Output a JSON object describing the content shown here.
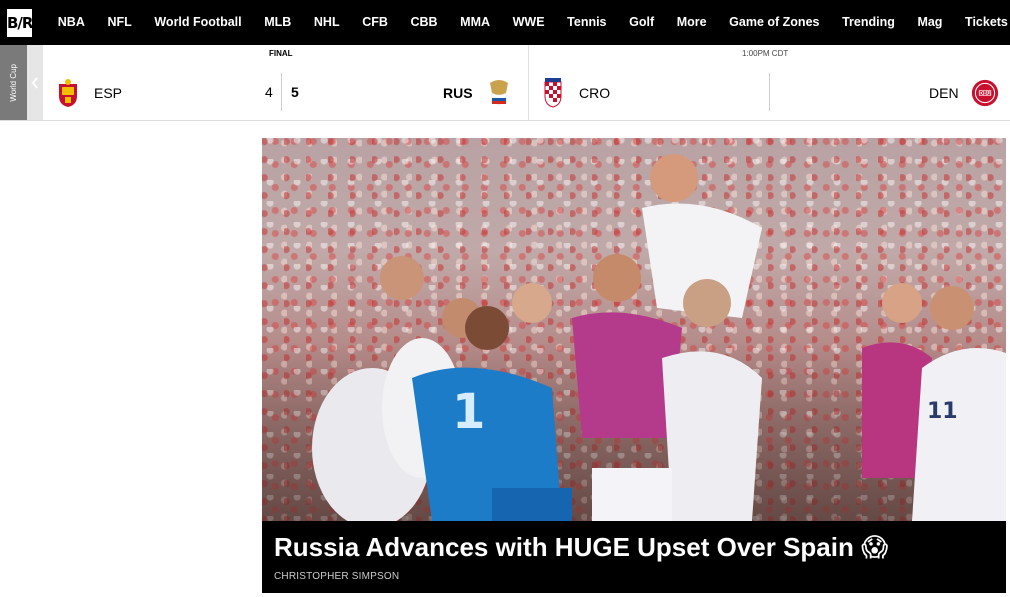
{
  "logo": "B/R",
  "nav": [
    "NBA",
    "NFL",
    "World Football",
    "MLB",
    "NHL",
    "CFB",
    "CBB",
    "MMA",
    "WWE",
    "Tennis",
    "Golf",
    "More",
    "Game of Zones",
    "Trending",
    "Mag",
    "Tickets"
  ],
  "scoreboard": {
    "league": "World Cup",
    "games": [
      {
        "status": "FINAL",
        "home": {
          "abbr": "ESP",
          "score": "4",
          "crest": "spain-crest-icon"
        },
        "away": {
          "abbr": "RUS",
          "score": "5",
          "crest": "russia-crest-icon"
        }
      },
      {
        "status": "1:00PM CDT",
        "home": {
          "abbr": "CRO",
          "crest": "croatia-crest-icon"
        },
        "away": {
          "abbr": "DEN",
          "crest": "denmark-crest-icon"
        }
      }
    ]
  },
  "article": {
    "headline": "Russia Advances with HUGE Upset Over Spain 😱",
    "author": "CHRISTOPHER SIMPSON",
    "image": "russia-team-celebrating-photo"
  },
  "colors": {
    "nav_bg": "#000000",
    "league_tab": "#7a7a7a",
    "headline_bg": "#000000"
  }
}
